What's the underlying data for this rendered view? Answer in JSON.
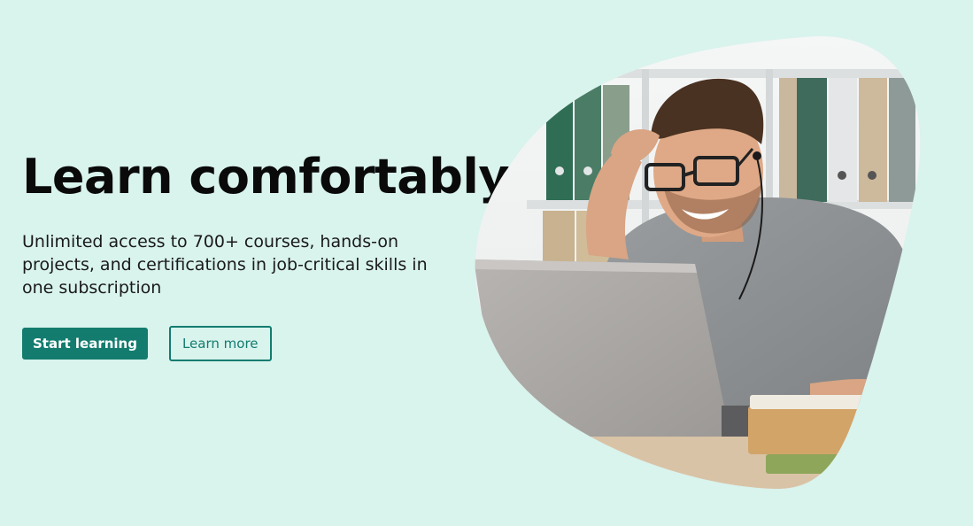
{
  "hero": {
    "title": "Learn comfortably",
    "subtitle": "Unlimited access to 700+ courses, hands-on projects, and certifications in job-critical skills in one subscription",
    "primary_cta": "Start learning",
    "secondary_cta": "Learn more"
  },
  "colors": {
    "background": "#d9f3ed",
    "accent": "#137c6f"
  },
  "image": {
    "subject": "smiling-man-with-laptop-photo"
  }
}
